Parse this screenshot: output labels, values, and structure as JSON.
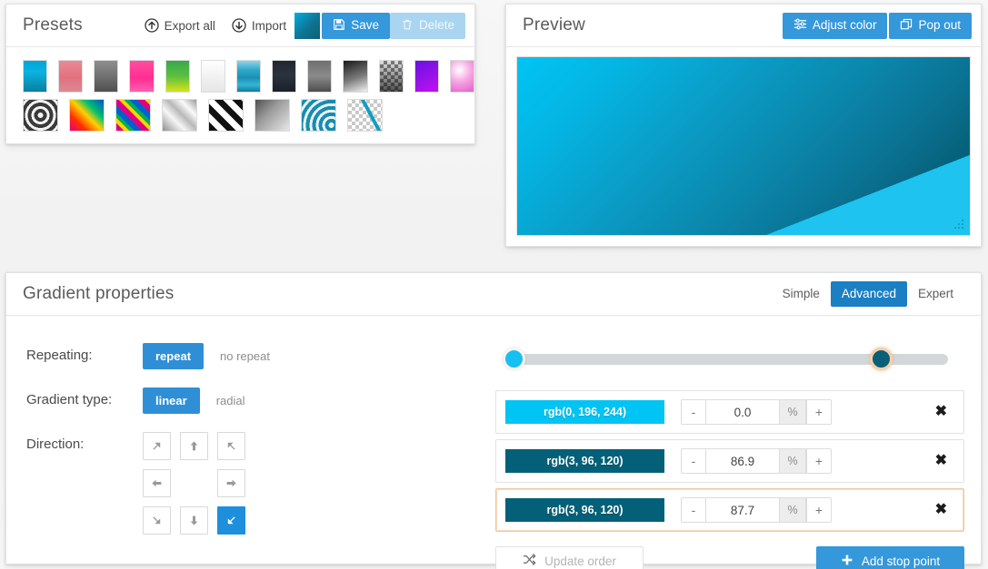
{
  "presets": {
    "title": "Presets",
    "export_all_label": "Export all",
    "import_label": "Import",
    "save_label": "Save",
    "delete_label": "Delete",
    "current_swatch": "linear-gradient(135deg,#00aee0,#0d5f78)",
    "items_row1": [
      {
        "name": "preset-cyan-blue",
        "css": "linear-gradient(180deg,#00a6d6 0%,#0bb3e0 35%,#0a7fa0 100%)"
      },
      {
        "name": "preset-salmon-pink",
        "css": "linear-gradient(180deg,#e88a95 0%,#e4707f 55%,#d98a93 100%)"
      },
      {
        "name": "preset-grey-dark",
        "css": "linear-gradient(180deg,#8e8e8e 0%,#6e6e6e 55%,#4f4f4f 100%)"
      },
      {
        "name": "preset-magenta",
        "css": "linear-gradient(180deg,#ff4fa0 0%,#ff2e92 55%,#ff5fae 100%)"
      },
      {
        "name": "preset-green-lime",
        "css": "linear-gradient(180deg,#37a84c 0%,#5cbf3f 50%,#d8e21a 100%)"
      },
      {
        "name": "preset-white-grey",
        "css": "linear-gradient(180deg,#ffffff 0%,#f2f2f2 50%,#e6e6e6 100%)"
      },
      {
        "name": "preset-sky-teal-stripes",
        "css": "linear-gradient(180deg,#8fd4e6 0%,#2ea8c8 30%,#1d90b4 55%,#36b6d6 78%,#0e7c9c 100%)"
      },
      {
        "name": "preset-navy-dark",
        "css": "linear-gradient(180deg,#20262f 0%,#2b3340 45%,#1b2029 100%)"
      },
      {
        "name": "preset-grey-mid",
        "css": "linear-gradient(180deg,#6f6f6f 0%,#8b8b8b 50%,#4d4d4d 100%)"
      },
      {
        "name": "preset-black-white-diag",
        "css": "linear-gradient(160deg,#1a1a1a 0%,#7a7a7a 55%,#f2f2f2 100%)"
      },
      {
        "name": "preset-checker-dark",
        "css": "checker-dark"
      },
      {
        "name": "preset-violet",
        "css": "linear-gradient(150deg,#6a0fe0 0%,#8a12e8 40%,#c310f0 100%)"
      },
      {
        "name": "preset-pink-white",
        "css": "radial-gradient(circle at 38% 30%,#ffffff 0%,#f7a6e2 45%,#e35ec8 100%)"
      }
    ],
    "items_row2": [
      {
        "name": "preset-radial-rings",
        "css": "radial"
      },
      {
        "name": "preset-rainbow-diagonal",
        "css": "linear-gradient(45deg,#e60080 0%,#ff2e00 25%,#ffd000 50%,#00c070 70%,#0050d0 100%)"
      },
      {
        "name": "preset-rainbow-stripes",
        "css": "repeating-linear-gradient(45deg,#e0007f 0 6px,#ffd400 6px 10px,#00b050 10px 14px,#0060d0 14px 20px)"
      },
      {
        "name": "preset-silver-diagonal",
        "css": "linear-gradient(45deg,#8f8f8f 0%,#f6f6f6 35%,#b8b8b8 55%,#fafafa 75%,#9a9a9a 100%)"
      },
      {
        "name": "preset-stripes-bw",
        "css": "repeating-linear-gradient(45deg,#111 0 7px,#fff 7px 14px)"
      },
      {
        "name": "preset-grey-diagonal",
        "css": "linear-gradient(135deg,#4f4f4f 0%,#9a9a9a 40%,#e8e8e8 100%)"
      },
      {
        "name": "preset-radial-teal",
        "css": "radial-teal"
      },
      {
        "name": "preset-transparent-line",
        "css": "checker-line"
      }
    ]
  },
  "preview": {
    "title": "Preview",
    "adjust_color_label": "Adjust color",
    "pop_out_label": "Pop out"
  },
  "gradient": {
    "title": "Gradient properties",
    "modes": [
      {
        "label": "Simple",
        "active": false
      },
      {
        "label": "Advanced",
        "active": true
      },
      {
        "label": "Expert",
        "active": false
      }
    ],
    "repeating": {
      "label": "Repeating:",
      "on_label": "repeat",
      "off_label": "no repeat",
      "value": "repeat"
    },
    "gradient_type": {
      "label": "Gradient type:",
      "on_label": "linear",
      "off_label": "radial",
      "value": "linear"
    },
    "direction": {
      "label": "Direction:",
      "selected": "down-right",
      "buttons": [
        "up-left",
        "up",
        "up-right",
        "left",
        "",
        "right",
        "down-left",
        "down",
        "down-right"
      ]
    },
    "slider": {
      "handles": [
        {
          "name": "stop-handle-1",
          "position_pct": 0.0,
          "color": "#17c0f0",
          "focused": false
        },
        {
          "name": "stop-handle-2",
          "position_pct": 86.9,
          "color": "#0b5f77",
          "focused": true
        }
      ]
    },
    "stops": [
      {
        "color_label": "rgb(0, 196, 244)",
        "color": "#00c4f4",
        "position": "0.0",
        "unit": "%",
        "minus": "-",
        "plus": "+",
        "remove": "✖",
        "selected": false
      },
      {
        "color_label": "rgb(3, 96, 120)",
        "color": "#036078",
        "position": "86.9",
        "unit": "%",
        "minus": "-",
        "plus": "+",
        "remove": "✖",
        "selected": false
      },
      {
        "color_label": "rgb(3, 96, 120)",
        "color": "#036078",
        "position": "87.7",
        "unit": "%",
        "minus": "-",
        "plus": "+",
        "remove": "✖",
        "selected": true
      }
    ],
    "update_order_label": "Update order",
    "add_stop_label": "Add stop point"
  },
  "colors": {
    "accent_blue": "#3498db",
    "active_blue": "#1b7fc4",
    "focus_tan": "#f0c69b",
    "panel_border": "#e2e2e2"
  }
}
